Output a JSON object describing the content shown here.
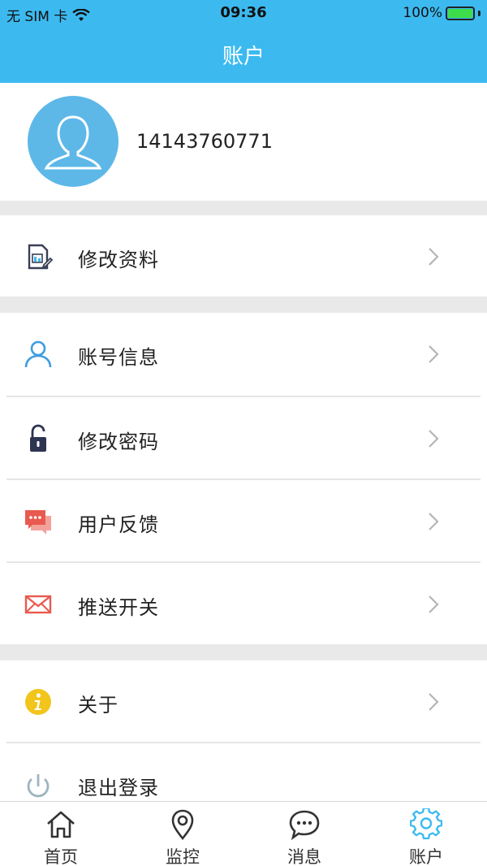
{
  "status_bar": {
    "carrier": "无 SIM 卡",
    "time": "09:36",
    "battery": "100%",
    "battery_level": 1.0
  },
  "nav": {
    "title": "账户"
  },
  "profile": {
    "phone": "14143760771"
  },
  "menu": {
    "edit_profile": "修改资料",
    "account_info": "账号信息",
    "change_password": "修改密码",
    "feedback": "用户反馈",
    "push_switch": "推送开关",
    "about": "关于",
    "logout": "退出登录"
  },
  "tabs": [
    {
      "label": "首页",
      "icon": "home-icon"
    },
    {
      "label": "监控",
      "icon": "location-pin-icon"
    },
    {
      "label": "消息",
      "icon": "chat-bubble-icon"
    },
    {
      "label": "账户",
      "icon": "gear-icon",
      "active": true
    }
  ],
  "colors": {
    "primary": "#3cbaf0",
    "avatar_bg": "#5db8e8",
    "active_tab": "#3cbaf0",
    "feedback": "#e85a4f",
    "info": "#f2c51c"
  }
}
